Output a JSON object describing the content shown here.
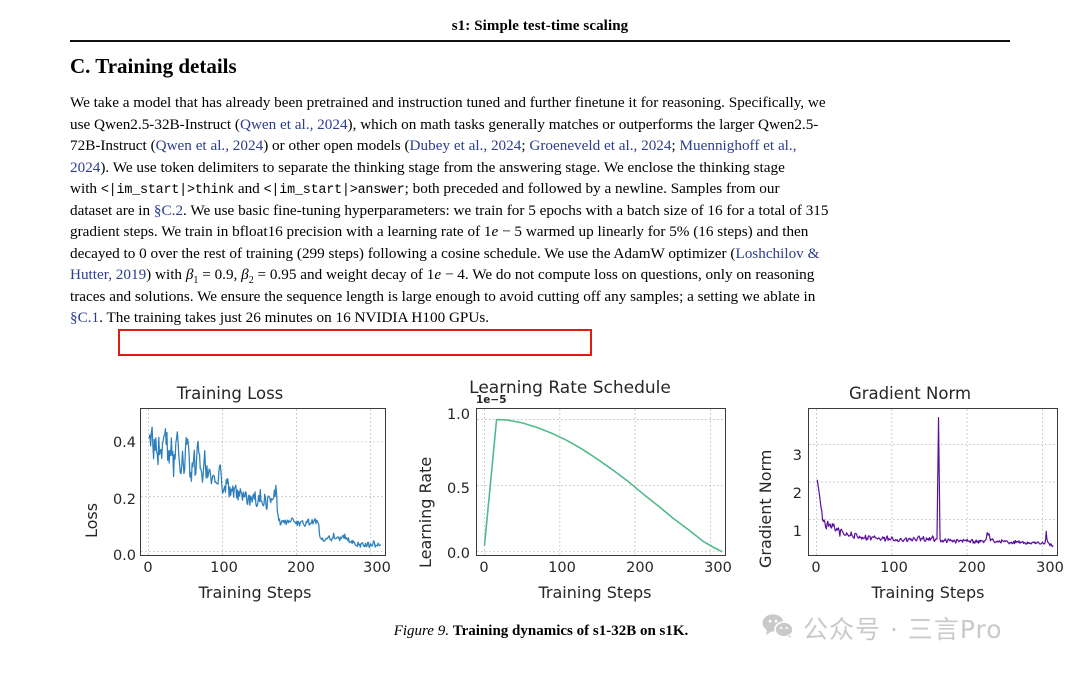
{
  "document": {
    "running_head": "s1: Simple test-time scaling",
    "section_heading": "C. Training details",
    "body_lines": [
      "We take a model that has already been pretrained and instruction tuned and further finetune it for reasoning. Specifically, we",
      "use Qwen2.5-32B-Instruct (Qwen et al., 2024), which on math tasks generally matches or outperforms the larger Qwen2.5-",
      "72B-Instruct (Qwen et al., 2024) or other open models (Dubey et al., 2024; Groeneveld et al., 2024; Muennighoff et al.,",
      "2024). We use token delimiters to separate the thinking stage from the answering stage. We enclose the thinking stage",
      "with <|im_start|>think and <|im_start|>answer; both preceded and followed by a newline. Samples from our",
      "dataset are in §C.2. We use basic fine-tuning hyperparameters: we train for 5 epochs with a batch size of 16 for a total of 315",
      "gradient steps. We train in bfloat16 precision with a learning rate of 1e − 5 warmed up linearly for 5% (16 steps) and then",
      "decayed to 0 over the rest of training (299 steps) following a cosine schedule. We use the AdamW optimizer (Loshchilov &",
      "Hutter, 2019) with β1 = 0.9, β2 = 0.95 and weight decay of 1e − 4. We do not compute loss on questions, only on reasoning",
      "traces and solutions. We ensure the sequence length is large enough to avoid cutting off any samples; a setting we ablate in",
      "§C.1. The training takes just 26 minutes on 16 NVIDIA H100 GPUs."
    ],
    "line1": {
      "a": "We take a model that has already been pretrained and instruction tuned and further finetune it for reasoning. Specifically, we"
    },
    "line2": {
      "a": "use Qwen2.5-32B-Instruct (",
      "cite1": "Qwen et al., 2024",
      "b": "), which on math tasks generally matches or outperforms the larger Qwen2.5-"
    },
    "line3": {
      "a": "72B-Instruct (",
      "cite1": "Qwen et al., 2024",
      "b": ") or other open models (",
      "cite2": "Dubey et al., 2024",
      "c": "; ",
      "cite3": "Groeneveld et al., 2024",
      "d": "; ",
      "cite4": "Muennighoff et al.,"
    },
    "line4": {
      "cite1": "2024",
      "a": "). We use token delimiters to separate the thinking stage from the answering stage. We enclose the thinking stage"
    },
    "line5": {
      "a": "with ",
      "mono1": "<|im_start|>think",
      "b": " and ",
      "mono2": "<|im_start|>answer",
      "c": "; both preceded and followed by a newline. Samples from our"
    },
    "line6": {
      "a": "dataset are in ",
      "cite1": "§C.2",
      "b": ". We use basic fine-tuning hyperparameters: we train for 5 epochs with a batch size of 16 for a total of 315"
    },
    "line7": {
      "a": "gradient steps. We train in bfloat16 precision with a learning rate of 1",
      "ital1": "e",
      "b": " − 5 warmed up linearly for 5% (16 steps) and then"
    },
    "line8": {
      "a": "decayed to 0 over the rest of training (299 steps) following a cosine schedule. We use the AdamW optimizer (",
      "cite1": "Loshchilov &"
    },
    "line9": {
      "cite1": "Hutter, 2019",
      "a": ") with ",
      "beta1": "β",
      "sub1": "1",
      "b": " = 0.9, ",
      "beta2": "β",
      "sub2": "2",
      "c": " = 0.95 and weight decay of 1",
      "ital1": "e",
      "d": " − 4. We do not compute loss on questions, only on reasoning"
    },
    "line10": {
      "a": "traces and solutions. We ensure the sequence length is large enough to avoid cutting off any samples; a setting we ablate in"
    },
    "line11": {
      "cite1": "§C.1",
      "a": ". The training takes just 26 minutes on 16 NVIDIA H100 GPUs."
    },
    "highlight": {
      "text": "The training takes just 26 minutes on 16 NVIDIA H100 GPUs.",
      "color": "#e01b15"
    },
    "caption": {
      "figure_number": "Figure 9.",
      "text": "Training dynamics of s1-32B on s1K."
    },
    "watermark": {
      "text": "公众号 · 三言Pro",
      "icon": "wechat-icon",
      "color": "#c9c9c9"
    }
  },
  "chart_data": [
    {
      "type": "line",
      "title": "Training Loss",
      "xlabel": "Training Steps",
      "ylabel": "Loss",
      "xlim": [
        -10,
        322
      ],
      "ylim": [
        -0.02,
        0.52
      ],
      "xticks": [
        "0",
        "100",
        "200",
        "300"
      ],
      "xtick_values": [
        0,
        100,
        200,
        300
      ],
      "yticks": [
        "0.0",
        "0.2",
        "0.4"
      ],
      "ytick_values": [
        0.0,
        0.2,
        0.4
      ],
      "grid": true,
      "color": "#2e7ebb",
      "series_name": "train/loss",
      "x": [
        1,
        4,
        7,
        10,
        13,
        16,
        19,
        22,
        25,
        28,
        31,
        34,
        37,
        40,
        43,
        46,
        49,
        52,
        55,
        58,
        61,
        64,
        67,
        70,
        73,
        76,
        79,
        82,
        85,
        88,
        91,
        94,
        97,
        100,
        103,
        106,
        109,
        112,
        115,
        118,
        121,
        124,
        127,
        130,
        133,
        136,
        139,
        142,
        145,
        148,
        151,
        154,
        157,
        160,
        163,
        166,
        169,
        172,
        175,
        178,
        181,
        184,
        187,
        190,
        193,
        196,
        199,
        202,
        205,
        208,
        211,
        214,
        217,
        220,
        223,
        226,
        229,
        232,
        235,
        238,
        241,
        244,
        247,
        250,
        253,
        256,
        259,
        262,
        265,
        268,
        271,
        274,
        277,
        280,
        283,
        286,
        289,
        292,
        295,
        298,
        301,
        304,
        307,
        310,
        313
      ],
      "values": [
        0.375,
        0.44,
        0.36,
        0.4,
        0.35,
        0.42,
        0.37,
        0.48,
        0.4,
        0.34,
        0.42,
        0.31,
        0.38,
        0.44,
        0.3,
        0.36,
        0.29,
        0.43,
        0.33,
        0.27,
        0.35,
        0.3,
        0.39,
        0.29,
        0.26,
        0.33,
        0.28,
        0.31,
        0.27,
        0.3,
        0.235,
        0.26,
        0.29,
        0.24,
        0.22,
        0.26,
        0.215,
        0.24,
        0.2,
        0.225,
        0.19,
        0.21,
        0.185,
        0.22,
        0.18,
        0.2,
        0.175,
        0.21,
        0.19,
        0.175,
        0.205,
        0.18,
        0.195,
        0.17,
        0.2,
        0.185,
        0.19,
        0.235,
        0.12,
        0.105,
        0.115,
        0.095,
        0.12,
        0.1,
        0.115,
        0.105,
        0.095,
        0.11,
        0.1,
        0.115,
        0.095,
        0.105,
        0.11,
        0.1,
        0.115,
        0.105,
        0.11,
        0.045,
        0.05,
        0.04,
        0.055,
        0.05,
        0.045,
        0.06,
        0.05,
        0.055,
        0.045,
        0.05,
        0.055,
        0.045,
        0.04,
        0.035,
        0.03,
        0.025,
        0.028,
        0.022,
        0.03,
        0.025,
        0.028,
        0.022,
        0.025,
        0.03,
        0.022,
        0.026,
        0.024
      ],
      "description": "Training loss decreasing in a staircase pattern with noisy oscillations from ~0.40 down to ~0.025, with distinct drops near steps 125, 190 and 255 corresponding to epoch boundaries."
    },
    {
      "type": "line",
      "title": "Learning Rate Schedule",
      "xlabel": "Training Steps",
      "ylabel": "Learning Rate",
      "offset_text": "1e−5",
      "xlim": [
        -10,
        322
      ],
      "ylim": [
        -0.04,
        1.08
      ],
      "xticks": [
        "0",
        "100",
        "200",
        "300"
      ],
      "xtick_values": [
        0,
        100,
        200,
        300
      ],
      "yticks": [
        "0.0",
        "0.5",
        "1.0"
      ],
      "ytick_values": [
        0.0,
        0.5,
        1.0
      ],
      "grid": true,
      "color": "#54b98a",
      "series_name": "train/learning_rate",
      "peak_value": 1.0,
      "warmup_steps": 16,
      "total_steps": 315,
      "description": "Linear warmup from 0.05e-5 at step 0 to peak 1.0e-5 at step 16, then cosine decay to 0 at step 315.",
      "x": [
        0,
        16,
        30,
        50,
        70,
        90,
        110,
        130,
        150,
        170,
        190,
        210,
        230,
        250,
        270,
        290,
        305,
        315
      ],
      "values": [
        0.05,
        1.0,
        0.997,
        0.975,
        0.94,
        0.895,
        0.84,
        0.775,
        0.7,
        0.62,
        0.535,
        0.44,
        0.35,
        0.255,
        0.17,
        0.08,
        0.03,
        0.002
      ]
    },
    {
      "type": "line",
      "title": "Gradient Norm",
      "xlabel": "Training Steps",
      "ylabel": "Gradient Norm",
      "xlim": [
        -10,
        322
      ],
      "ylim": [
        0.0,
        3.95
      ],
      "xticks": [
        "0",
        "100",
        "200",
        "300"
      ],
      "xtick_values": [
        0,
        100,
        200,
        300
      ],
      "yticks": [
        "1",
        "2",
        "3"
      ],
      "ytick_values": [
        1,
        2,
        3
      ],
      "grid": true,
      "color": "#5b0f9e",
      "series_name": "train/grad_norm",
      "spike_step": 162,
      "spike_value": 3.72,
      "description": "Gradient norm starts near 2.05, decays quickly to a noisy plateau around 0.4-0.5, with a single large spike to ~3.7 at step ~162 and smaller spikes near steps 228 and 305.",
      "x": [
        1,
        4,
        7,
        10,
        13,
        16,
        19,
        22,
        25,
        28,
        31,
        34,
        37,
        40,
        43,
        46,
        49,
        52,
        55,
        58,
        61,
        64,
        67,
        70,
        73,
        76,
        79,
        82,
        85,
        88,
        91,
        94,
        97,
        100,
        103,
        106,
        109,
        112,
        115,
        118,
        121,
        124,
        127,
        130,
        133,
        136,
        139,
        142,
        145,
        148,
        151,
        154,
        157,
        160,
        162,
        164,
        167,
        170,
        173,
        176,
        179,
        182,
        185,
        188,
        191,
        194,
        197,
        200,
        203,
        206,
        209,
        212,
        215,
        218,
        221,
        224,
        228,
        231,
        234,
        237,
        240,
        243,
        246,
        249,
        252,
        255,
        258,
        261,
        264,
        267,
        270,
        273,
        276,
        279,
        282,
        285,
        288,
        291,
        294,
        297,
        300,
        303,
        305,
        308,
        311,
        314
      ],
      "values": [
        2.05,
        1.65,
        1.15,
        0.95,
        0.82,
        0.9,
        0.74,
        0.85,
        0.68,
        0.78,
        0.62,
        0.72,
        0.58,
        0.66,
        0.55,
        0.63,
        0.52,
        0.6,
        0.5,
        0.58,
        0.49,
        0.56,
        0.48,
        0.55,
        0.47,
        0.54,
        0.46,
        0.53,
        0.45,
        0.52,
        0.45,
        0.51,
        0.44,
        0.5,
        0.44,
        0.5,
        0.43,
        0.49,
        0.43,
        0.48,
        0.43,
        0.49,
        0.44,
        0.5,
        0.45,
        0.51,
        0.44,
        0.5,
        0.44,
        0.52,
        0.45,
        0.51,
        0.44,
        0.48,
        3.72,
        0.47,
        0.43,
        0.47,
        0.42,
        0.46,
        0.42,
        0.45,
        0.41,
        0.45,
        0.41,
        0.44,
        0.41,
        0.44,
        0.4,
        0.44,
        0.4,
        0.43,
        0.4,
        0.43,
        0.41,
        0.44,
        0.66,
        0.42,
        0.45,
        0.41,
        0.44,
        0.4,
        0.43,
        0.39,
        0.42,
        0.38,
        0.41,
        0.37,
        0.4,
        0.38,
        0.41,
        0.37,
        0.4,
        0.36,
        0.39,
        0.36,
        0.39,
        0.35,
        0.38,
        0.35,
        0.37,
        0.34,
        0.62,
        0.35,
        0.33,
        0.3
      ]
    }
  ]
}
